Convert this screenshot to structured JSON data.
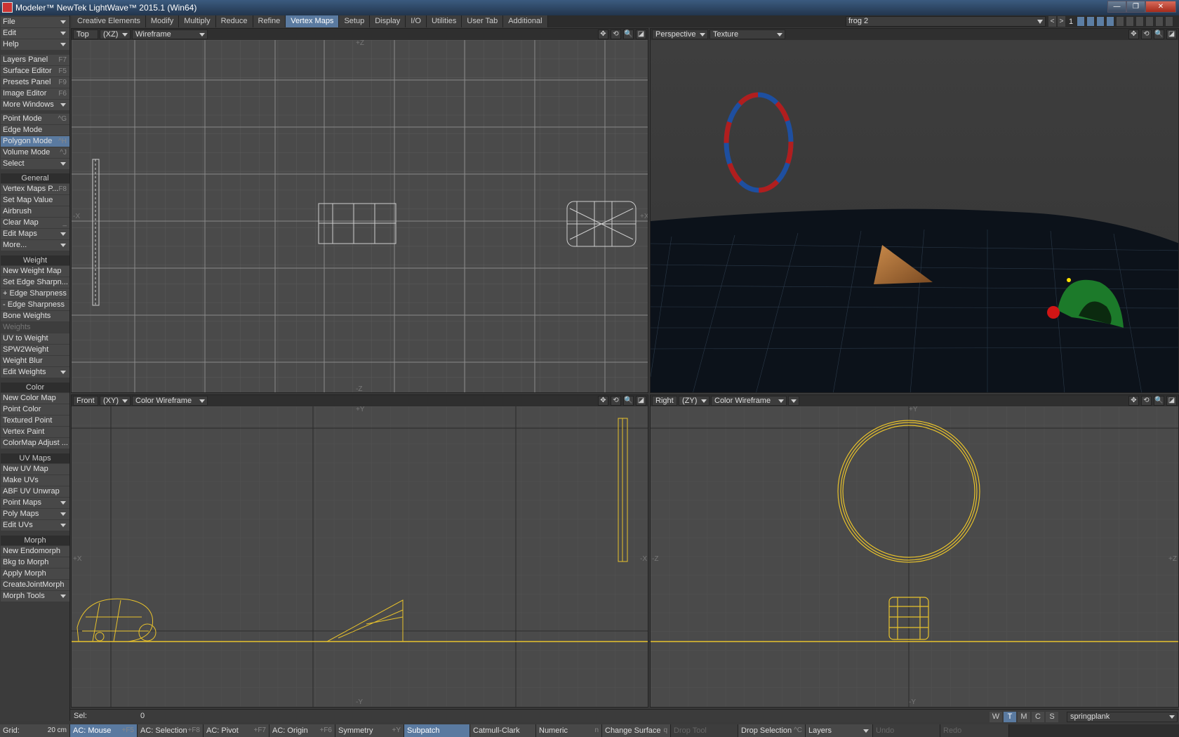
{
  "title": "Modeler™ NewTek LightWave™ 2015.1 (Win64)",
  "window_buttons": {
    "minimize": "—",
    "maximize": "❐",
    "close": "✕"
  },
  "tabs": [
    "Creative Elements",
    "Modify",
    "Multiply",
    "Reduce",
    "Refine",
    "Vertex Maps",
    "Setup",
    "Display",
    "I/O",
    "Utilities",
    "User Tab",
    "Additional"
  ],
  "active_tab": "Vertex Maps",
  "object_selector": "frog 2",
  "layer": {
    "number": "1",
    "prev": "<",
    "next": ">"
  },
  "sidebar": {
    "menus": [
      {
        "label": "File",
        "dropdown": true
      },
      {
        "label": "Edit",
        "dropdown": true
      },
      {
        "label": "Help",
        "dropdown": true
      }
    ],
    "windows": [
      {
        "label": "Layers Panel",
        "key": "F7"
      },
      {
        "label": "Surface Editor",
        "key": "F5"
      },
      {
        "label": "Presets Panel",
        "key": "F9"
      },
      {
        "label": "Image Editor",
        "key": "F6"
      },
      {
        "label": "More Windows",
        "dropdown": true
      }
    ],
    "modes": [
      {
        "label": "Point Mode",
        "key": "^G"
      },
      {
        "label": "Edge Mode",
        "key": ""
      },
      {
        "label": "Polygon Mode",
        "key": "^H",
        "active": true
      },
      {
        "label": "Volume Mode",
        "key": "^J"
      },
      {
        "label": "Select",
        "dropdown": true
      }
    ],
    "general_header": "General",
    "general": [
      {
        "label": "Vertex Maps P...",
        "key": "F8"
      },
      {
        "label": "Set Map Value"
      },
      {
        "label": "Airbrush"
      },
      {
        "label": "Clear Map",
        "key": "_"
      },
      {
        "label": "Edit Maps",
        "dropdown": true
      },
      {
        "label": "More...",
        "dropdown": true
      }
    ],
    "weight_header": "Weight",
    "weight": [
      {
        "label": "New Weight Map"
      },
      {
        "label": "Set Edge Sharpn..."
      },
      {
        "label": "+ Edge Sharpness"
      },
      {
        "label": "- Edge Sharpness"
      },
      {
        "label": "Bone Weights"
      },
      {
        "label": "Weights",
        "dim": true
      },
      {
        "label": "UV to Weight"
      },
      {
        "label": "SPW2Weight"
      },
      {
        "label": "Weight Blur"
      },
      {
        "label": "Edit Weights",
        "dropdown": true
      }
    ],
    "color_header": "Color",
    "color": [
      {
        "label": "New Color Map"
      },
      {
        "label": "Point Color"
      },
      {
        "label": "Textured Point"
      },
      {
        "label": "Vertex Paint"
      },
      {
        "label": "ColorMap Adjust ..."
      }
    ],
    "uv_header": "UV Maps",
    "uv": [
      {
        "label": "New UV Map"
      },
      {
        "label": "Make UVs"
      },
      {
        "label": "ABF UV Unwrap"
      },
      {
        "label": "Point Maps",
        "dropdown": true
      },
      {
        "label": "Poly Maps",
        "dropdown": true
      },
      {
        "label": "Edit UVs",
        "dropdown": true
      }
    ],
    "morph_header": "Morph",
    "morph": [
      {
        "label": "New Endomorph"
      },
      {
        "label": "Bkg to Morph"
      },
      {
        "label": "Apply Morph"
      },
      {
        "label": "CreateJointMorph"
      },
      {
        "label": "Morph Tools",
        "dropdown": true
      }
    ]
  },
  "viewports": {
    "top": {
      "view": "Top",
      "axes": "(XZ)",
      "render": "Wireframe",
      "axis_top": "+Z",
      "axis_bottom": "-Z",
      "axis_left": "-X",
      "axis_right": "+X"
    },
    "perspective": {
      "view": "Perspective",
      "render": "Texture"
    },
    "front": {
      "view": "Front",
      "axes": "(XY)",
      "render": "Color Wireframe",
      "axis_top": "+Y",
      "axis_bottom": "-Y",
      "axis_left": "+X",
      "axis_right": "-X"
    },
    "right": {
      "view": "Right",
      "axes": "(ZY)",
      "render": "Color Wireframe",
      "axis_top": "+Y",
      "axis_bottom": "-Y",
      "axis_left": "-Z",
      "axis_right": "+Z"
    }
  },
  "viewport_tools": {
    "move": "✥",
    "rotate": "⟲",
    "zoom": "🔍",
    "max": "◪"
  },
  "status": {
    "sel_label": "Sel:",
    "sel_value": "0"
  },
  "wtmcs": [
    "W",
    "T",
    "M",
    "C",
    "S"
  ],
  "wtmcs_active": "T",
  "surface_selector": "springplank",
  "bottom": [
    {
      "label": "Grid:",
      "value": "20 cm"
    },
    {
      "label": "AC: Mouse",
      "key": "+F5",
      "active": true
    },
    {
      "label": "AC: Selection",
      "key": "+F8"
    },
    {
      "label": "AC: Pivot",
      "key": "+F7"
    },
    {
      "label": "AC: Origin",
      "key": "+F6"
    },
    {
      "label": "Symmetry",
      "key": "+Y"
    },
    {
      "label": "Subpatch",
      "active": true
    },
    {
      "label": "Catmull-Clark"
    },
    {
      "label": "Numeric",
      "key": "n"
    },
    {
      "label": "Change Surface",
      "key": "q"
    },
    {
      "label": "Drop Tool",
      "dim": true
    },
    {
      "label": "Drop Selection",
      "key": "^C"
    },
    {
      "label": "Layers",
      "dropdown": true
    },
    {
      "label": "Undo",
      "dim": true
    },
    {
      "label": "Redo",
      "dim": true
    }
  ]
}
